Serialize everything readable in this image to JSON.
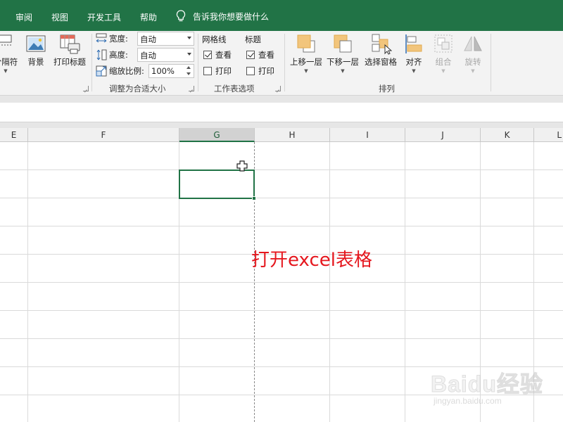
{
  "menu": {
    "tabs": [
      "审阅",
      "视图",
      "开发工具",
      "帮助"
    ],
    "tell_me": "告诉我你想要做什么"
  },
  "ribbon": {
    "page_setup": {
      "breaks_label": "分隔符",
      "background_label": "背景",
      "print_titles_label": "打印标题"
    },
    "scale_to_fit": {
      "group_label": "调整为合适大小",
      "width_label": "宽度:",
      "width_value": "自动",
      "height_label": "高度:",
      "height_value": "自动",
      "scale_label": "缩放比例:",
      "scale_value": "100%"
    },
    "sheet_options": {
      "group_label": "工作表选项",
      "gridlines_header": "网格线",
      "headings_header": "标题",
      "view_label": "查看",
      "print_label": "打印",
      "gridlines_view_checked": true,
      "gridlines_print_checked": false,
      "headings_view_checked": true,
      "headings_print_checked": false
    },
    "arrange": {
      "group_label": "排列",
      "bring_forward": "上移一层",
      "send_backward": "下移一层",
      "selection_pane": "选择窗格",
      "align": "对齐",
      "group": "组合",
      "rotate": "旋转"
    }
  },
  "sheet": {
    "columns": [
      "E",
      "F",
      "G",
      "H",
      "I",
      "J",
      "K",
      "L"
    ],
    "selected_column": "G",
    "annotation": "打开excel表格"
  },
  "watermark": {
    "brand": "Baidu经验",
    "url": "jingyan.baidu.com"
  },
  "colors": {
    "accent": "#217346",
    "annotation": "#e5171e"
  }
}
